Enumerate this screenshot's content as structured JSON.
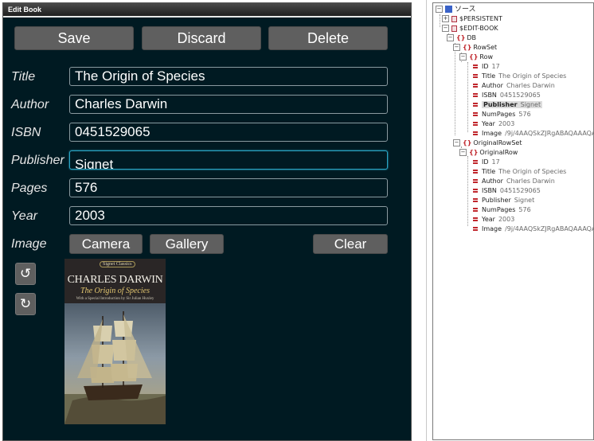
{
  "window": {
    "title": "Edit Book"
  },
  "toolbar": {
    "save": "Save",
    "discard": "Discard",
    "delete": "Delete"
  },
  "form": {
    "title_label": "Title",
    "title_value": "The Origin of Species",
    "author_label": "Author",
    "author_value": "Charles Darwin",
    "isbn_label": "ISBN",
    "isbn_value": "0451529065",
    "publisher_label": "Publisher",
    "publisher_value": "Signet",
    "pages_label": "Pages",
    "pages_value": "576",
    "year_label": "Year",
    "year_value": "2003",
    "image_label": "Image"
  },
  "image_buttons": {
    "camera": "Camera",
    "gallery": "Gallery",
    "clear": "Clear"
  },
  "rotate": {
    "left_icon": "↺",
    "right_icon": "↻"
  },
  "cover": {
    "badge": "Signet Classics",
    "author": "CHARLES DARWIN",
    "subtitle": "The Origin of Species",
    "intro": "With a Special Introduction by Sir Julian Huxley"
  },
  "tree": {
    "root": "ソース",
    "persistent": "$PERSISTENT",
    "editbook": "$EDIT-BOOK",
    "db": "DB",
    "rowset": "RowSet",
    "row": "Row",
    "row_fields": [
      {
        "name": "ID",
        "value": "17"
      },
      {
        "name": "Title",
        "value": "The Origin of Species"
      },
      {
        "name": "Author",
        "value": "Charles Darwin"
      },
      {
        "name": "ISBN",
        "value": "0451529065"
      },
      {
        "name": "Publisher",
        "value": "Signet"
      },
      {
        "name": "NumPages",
        "value": "576"
      },
      {
        "name": "Year",
        "value": "2003"
      },
      {
        "name": "Image",
        "value": "/9j/4AAQSkZJRgABAQAAAQABA"
      }
    ],
    "original_rowset": "OriginalRowSet",
    "original_row": "OriginalRow",
    "orig_fields": [
      {
        "name": "ID",
        "value": "17"
      },
      {
        "name": "Title",
        "value": "The Origin of Species"
      },
      {
        "name": "Author",
        "value": "Charles Darwin"
      },
      {
        "name": "ISBN",
        "value": "0451529065"
      },
      {
        "name": "Publisher",
        "value": "Signet"
      },
      {
        "name": "NumPages",
        "value": "576"
      },
      {
        "name": "Year",
        "value": "2003"
      },
      {
        "name": "Image",
        "value": "/9j/4AAQSkZJRgABAQAAAQABA"
      }
    ]
  },
  "colors": {
    "app_bg": "#001a22",
    "button": "#5f5f5f",
    "focus": "#2aa7c6",
    "tree_icon": "#c0262c"
  }
}
